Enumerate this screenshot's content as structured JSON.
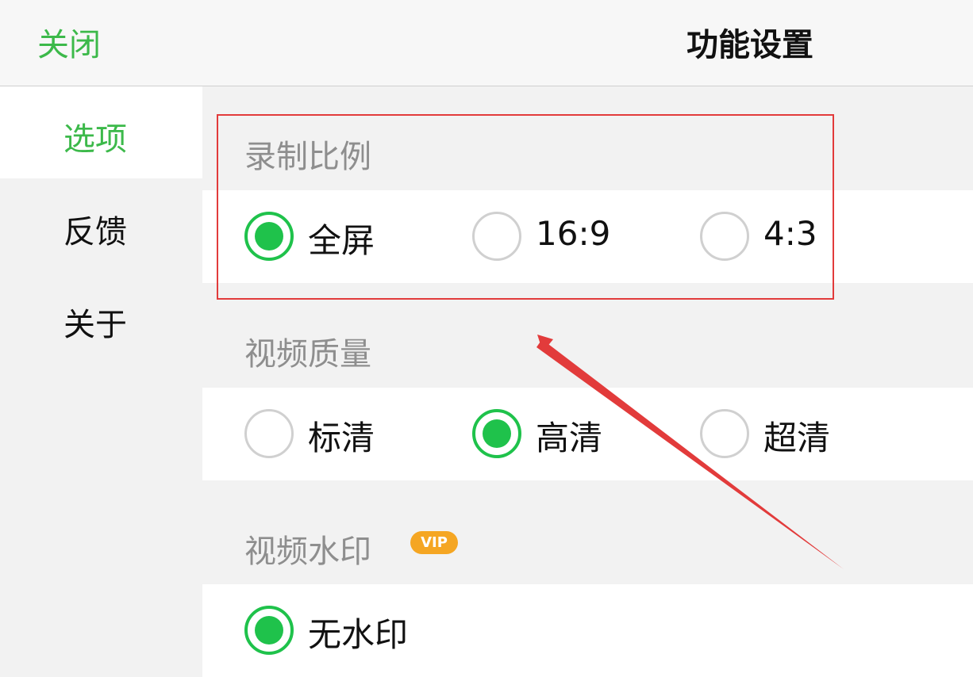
{
  "header": {
    "close_label": "关闭",
    "title": "功能设置"
  },
  "sidebar": {
    "items": [
      {
        "label": "选项",
        "active": true
      },
      {
        "label": "反馈",
        "active": false
      },
      {
        "label": "关于",
        "active": false
      }
    ]
  },
  "sections": [
    {
      "label": "录制比例",
      "options": [
        {
          "label": "全屏",
          "selected": true
        },
        {
          "label": "16:9",
          "selected": false
        },
        {
          "label": "4:3",
          "selected": false
        }
      ]
    },
    {
      "label": "视频质量",
      "options": [
        {
          "label": "标清",
          "selected": false
        },
        {
          "label": "高清",
          "selected": true
        },
        {
          "label": "超清",
          "selected": false
        }
      ]
    },
    {
      "label": "视频水印",
      "badge": "VIP",
      "options": [
        {
          "label": "无水印",
          "selected": true
        }
      ]
    }
  ],
  "colors": {
    "accent": "#1fc24b",
    "link_green": "#3cb94a",
    "annotation_red": "#e23b3b",
    "vip_orange": "#f5a623"
  }
}
